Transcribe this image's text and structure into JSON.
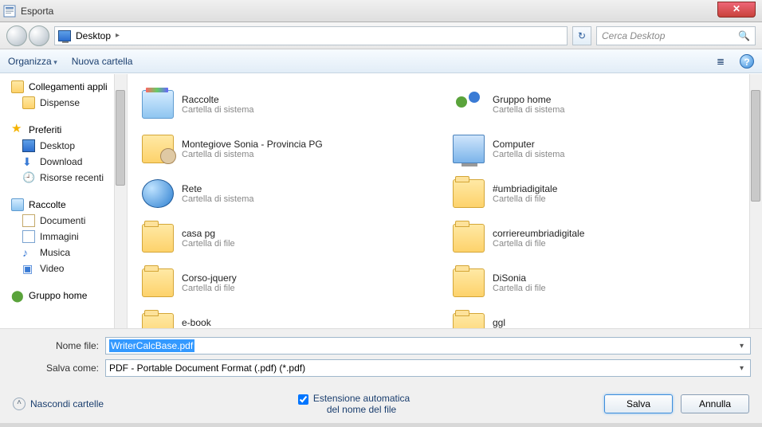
{
  "window": {
    "title": "Esporta",
    "close_glyph": "✕"
  },
  "nav": {
    "location_label": "Desktop",
    "chevron": "▸",
    "refresh_glyph": "↻",
    "search_placeholder": "Cerca Desktop",
    "search_glyph": "🔍"
  },
  "toolbar": {
    "organize": "Organizza",
    "new_folder": "Nuova cartella",
    "view_glyph": "≣",
    "help_glyph": "?"
  },
  "sidebar": {
    "items": [
      {
        "kind": "head",
        "icon": "folder",
        "label": "Collegamenti appli"
      },
      {
        "kind": "sub",
        "icon": "folder",
        "label": "Dispense"
      },
      {
        "kind": "gap"
      },
      {
        "kind": "head",
        "icon": "star",
        "label": "Preferiti"
      },
      {
        "kind": "sub",
        "icon": "mon",
        "label": "Desktop"
      },
      {
        "kind": "sub",
        "icon": "dl",
        "label": "Download"
      },
      {
        "kind": "sub",
        "icon": "clock",
        "label": "Risorse recenti"
      },
      {
        "kind": "gap"
      },
      {
        "kind": "head",
        "icon": "lib",
        "label": "Raccolte"
      },
      {
        "kind": "sub",
        "icon": "doc",
        "label": "Documenti"
      },
      {
        "kind": "sub",
        "icon": "img",
        "label": "Immagini"
      },
      {
        "kind": "sub",
        "icon": "music",
        "label": "Musica"
      },
      {
        "kind": "sub",
        "icon": "video",
        "label": "Video"
      },
      {
        "kind": "gap"
      },
      {
        "kind": "head",
        "icon": "home",
        "label": "Gruppo home"
      }
    ]
  },
  "content": {
    "sys_sub": "Cartella di sistema",
    "file_sub": "Cartella di file",
    "col1": [
      {
        "icon": "lib",
        "name": "Raccolte",
        "sub": "sys"
      },
      {
        "icon": "user",
        "name": "Montegiove  Sonia - Provincia PG",
        "sub": "sys"
      },
      {
        "icon": "net",
        "name": "Rete",
        "sub": "sys"
      },
      {
        "icon": "folder",
        "name": "casa pg",
        "sub": "file"
      },
      {
        "icon": "folder",
        "name": "Corso-jquery",
        "sub": "file"
      },
      {
        "icon": "folder",
        "name": "e-book",
        "sub": "file"
      }
    ],
    "col2": [
      {
        "icon": "home",
        "name": "Gruppo home",
        "sub": "sys"
      },
      {
        "icon": "comp",
        "name": "Computer",
        "sub": "sys"
      },
      {
        "icon": "folder",
        "name": "#umbriadigitale",
        "sub": "file"
      },
      {
        "icon": "folder",
        "name": "corriereumbriadigitale",
        "sub": "file"
      },
      {
        "icon": "folder",
        "name": "DiSonia",
        "sub": "file"
      },
      {
        "icon": "folder",
        "name": "ggl",
        "sub": "file"
      }
    ]
  },
  "form": {
    "filename_label": "Nome file:",
    "filename_value": "WriterCalcBase.pdf",
    "savetype_label": "Salva come:",
    "savetype_value": "PDF - Portable Document Format (.pdf) (*.pdf)"
  },
  "footer": {
    "hide_label": "Nascondi cartelle",
    "autoext_line1": "Estensione automatica",
    "autoext_line2": "del nome del file",
    "save_label": "Salva",
    "cancel_label": "Annulla"
  }
}
